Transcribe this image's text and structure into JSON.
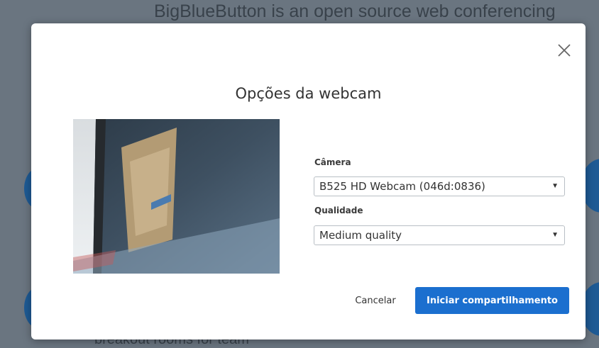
{
  "background": {
    "top_text": "BigBlueButton is an open source web conferencing",
    "bottom_text": "breakout rooms for team"
  },
  "modal": {
    "title": "Opções da webcam",
    "camera_label": "Câmera",
    "camera_value": "B525 HD Webcam (046d:0836)",
    "quality_label": "Qualidade",
    "quality_value": "Medium quality",
    "cancel_label": "Cancelar",
    "start_label": "Iniciar compartilhamento"
  },
  "colors": {
    "primary": "#1b6fcf",
    "overlay": "#6a7580"
  },
  "icons": {
    "close": "close-icon",
    "dropdown": "caret-down-icon"
  }
}
